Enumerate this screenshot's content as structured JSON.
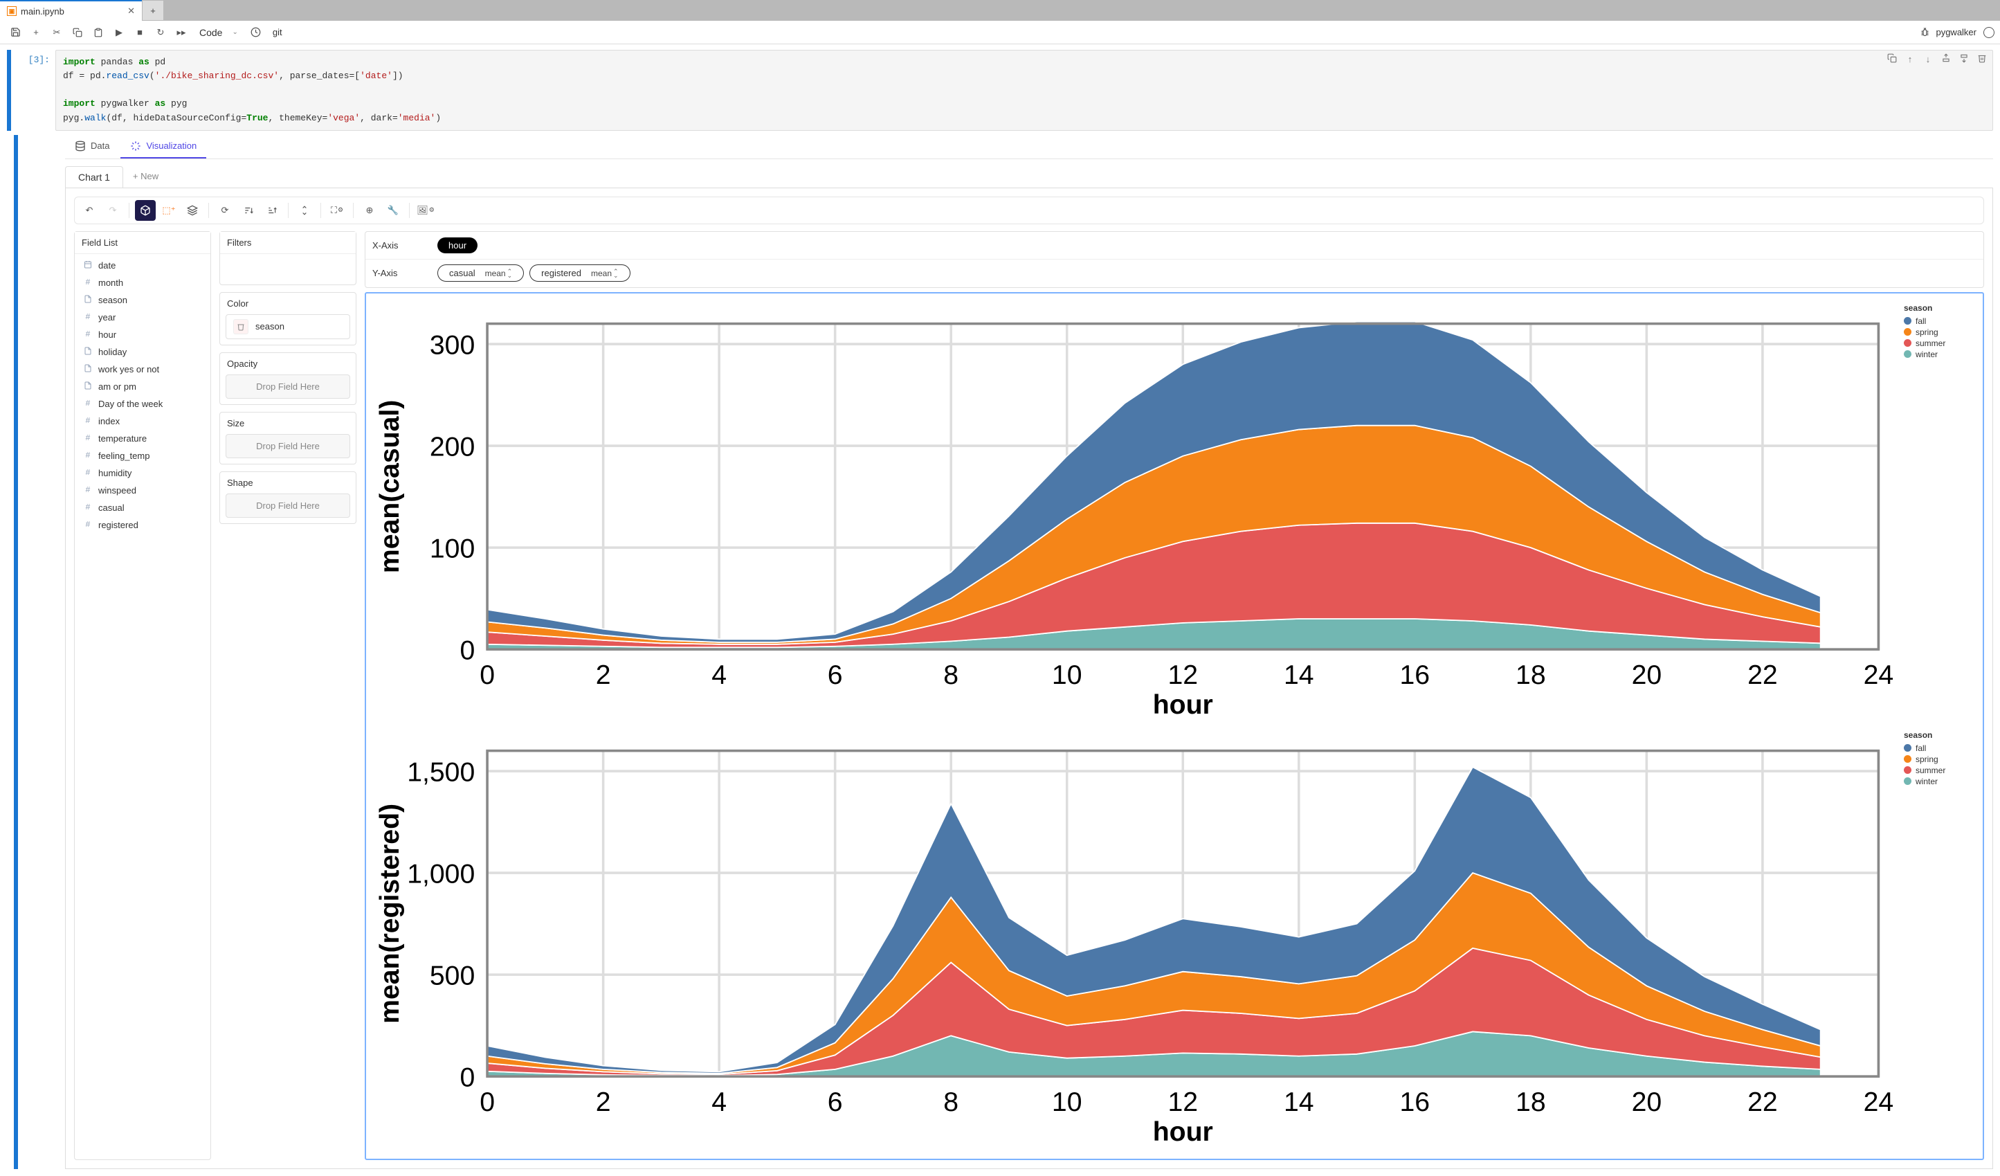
{
  "tab": {
    "filename": "main.ipynb"
  },
  "toolbar": {
    "celltype": "Code",
    "git": "git",
    "kernel": "pygwalker"
  },
  "cell": {
    "prompt": "[3]:",
    "code_lines": [
      [
        {
          "t": "import ",
          "c": "kw-green"
        },
        {
          "t": "pandas ",
          "c": ""
        },
        {
          "t": "as ",
          "c": "kw-green"
        },
        {
          "t": "pd",
          "c": ""
        }
      ],
      [
        {
          "t": "df ",
          "c": ""
        },
        {
          "t": "= ",
          "c": ""
        },
        {
          "t": "pd.",
          "c": ""
        },
        {
          "t": "read_csv",
          "c": "fn"
        },
        {
          "t": "(",
          "c": ""
        },
        {
          "t": "'./bike_sharing_dc.csv'",
          "c": "str"
        },
        {
          "t": ", parse_dates=[",
          "c": ""
        },
        {
          "t": "'date'",
          "c": "str"
        },
        {
          "t": "])",
          "c": ""
        }
      ],
      [],
      [
        {
          "t": "import ",
          "c": "kw-green"
        },
        {
          "t": "pygwalker ",
          "c": ""
        },
        {
          "t": "as ",
          "c": "kw-green"
        },
        {
          "t": "pyg",
          "c": ""
        }
      ],
      [
        {
          "t": "pyg.",
          "c": ""
        },
        {
          "t": "walk",
          "c": "fn"
        },
        {
          "t": "(df, hideDataSourceConfig=",
          "c": ""
        },
        {
          "t": "True",
          "c": "kw-green"
        },
        {
          "t": ", themeKey=",
          "c": ""
        },
        {
          "t": "'vega'",
          "c": "str"
        },
        {
          "t": ", dark=",
          "c": ""
        },
        {
          "t": "'media'",
          "c": "str"
        },
        {
          "t": ")",
          "c": ""
        }
      ]
    ]
  },
  "viz": {
    "tabs": {
      "data": "Data",
      "visualization": "Visualization"
    },
    "charttab": "Chart 1",
    "newtab": "+ New",
    "field_list_label": "Field List",
    "fields": [
      {
        "name": "date",
        "icon": "cal"
      },
      {
        "name": "month",
        "icon": "hash"
      },
      {
        "name": "season",
        "icon": "doc"
      },
      {
        "name": "year",
        "icon": "hash"
      },
      {
        "name": "hour",
        "icon": "hash"
      },
      {
        "name": "holiday",
        "icon": "doc"
      },
      {
        "name": "work yes or not",
        "icon": "doc"
      },
      {
        "name": "am or pm",
        "icon": "doc"
      },
      {
        "name": "Day of the week",
        "icon": "hash"
      },
      {
        "name": "index",
        "icon": "hash"
      },
      {
        "name": "temperature",
        "icon": "hash"
      },
      {
        "name": "feeling_temp",
        "icon": "hash"
      },
      {
        "name": "humidity",
        "icon": "hash"
      },
      {
        "name": "winspeed",
        "icon": "hash"
      },
      {
        "name": "casual",
        "icon": "hash"
      },
      {
        "name": "registered",
        "icon": "hash"
      }
    ],
    "encodings": {
      "filters": "Filters",
      "color": "Color",
      "color_field": "season",
      "opacity": "Opacity",
      "size": "Size",
      "shape": "Shape",
      "drop": "Drop Field Here"
    },
    "shelves": {
      "x": "X-Axis",
      "y": "Y-Axis",
      "x_field": "hour",
      "y_fields": [
        {
          "name": "casual",
          "agg": "mean"
        },
        {
          "name": "registered",
          "agg": "mean"
        }
      ]
    },
    "legend_title": "season",
    "legend_items": [
      {
        "name": "fall",
        "color": "#4c78a8"
      },
      {
        "name": "spring",
        "color": "#f58518"
      },
      {
        "name": "summer",
        "color": "#e45756"
      },
      {
        "name": "winter",
        "color": "#72b7b2"
      }
    ]
  },
  "chart_data": [
    {
      "type": "area",
      "stacked": true,
      "title": "",
      "xlabel": "hour",
      "ylabel": "mean(casual)",
      "x": [
        0,
        1,
        2,
        3,
        4,
        5,
        6,
        7,
        8,
        9,
        10,
        11,
        12,
        13,
        14,
        15,
        16,
        17,
        18,
        19,
        20,
        21,
        22,
        23
      ],
      "x_ticks": [
        0,
        2,
        4,
        6,
        8,
        10,
        12,
        14,
        16,
        18,
        20,
        22,
        24
      ],
      "ylim": [
        0,
        320
      ],
      "y_ticks": [
        0,
        100,
        200,
        300
      ],
      "series": [
        {
          "name": "winter",
          "color": "#72b7b2",
          "values": [
            5,
            4,
            3,
            2,
            2,
            2,
            3,
            5,
            8,
            12,
            18,
            22,
            26,
            28,
            30,
            30,
            30,
            28,
            24,
            18,
            14,
            10,
            8,
            6
          ]
        },
        {
          "name": "summer",
          "color": "#e45756",
          "values": [
            12,
            9,
            6,
            4,
            3,
            3,
            4,
            10,
            20,
            35,
            52,
            68,
            80,
            88,
            92,
            94,
            94,
            88,
            76,
            60,
            46,
            34,
            24,
            16
          ]
        },
        {
          "name": "spring",
          "color": "#f58518",
          "values": [
            10,
            8,
            5,
            3,
            2,
            2,
            3,
            10,
            22,
            40,
            58,
            74,
            84,
            90,
            94,
            96,
            96,
            92,
            80,
            62,
            46,
            32,
            22,
            14
          ]
        },
        {
          "name": "fall",
          "color": "#4c78a8",
          "values": [
            12,
            9,
            6,
            4,
            3,
            3,
            5,
            12,
            26,
            44,
            62,
            78,
            90,
            96,
            100,
            102,
            102,
            96,
            82,
            64,
            48,
            34,
            24,
            16
          ]
        }
      ]
    },
    {
      "type": "area",
      "stacked": true,
      "title": "",
      "xlabel": "hour",
      "ylabel": "mean(registered)",
      "x": [
        0,
        1,
        2,
        3,
        4,
        5,
        6,
        7,
        8,
        9,
        10,
        11,
        12,
        13,
        14,
        15,
        16,
        17,
        18,
        19,
        20,
        21,
        22,
        23
      ],
      "x_ticks": [
        0,
        2,
        4,
        6,
        8,
        10,
        12,
        14,
        16,
        18,
        20,
        22,
        24
      ],
      "ylim": [
        0,
        1600
      ],
      "y_ticks": [
        0,
        500,
        1000,
        1500
      ],
      "series": [
        {
          "name": "winter",
          "color": "#72b7b2",
          "values": [
            25,
            15,
            8,
            5,
            4,
            10,
            35,
            100,
            200,
            120,
            90,
            100,
            115,
            110,
            100,
            110,
            150,
            220,
            200,
            140,
            100,
            70,
            50,
            35
          ]
        },
        {
          "name": "summer",
          "color": "#e45756",
          "values": [
            40,
            25,
            15,
            8,
            6,
            18,
            70,
            200,
            360,
            210,
            160,
            180,
            210,
            200,
            185,
            200,
            270,
            410,
            370,
            260,
            180,
            130,
            95,
            60
          ]
        },
        {
          "name": "spring",
          "color": "#f58518",
          "values": [
            35,
            22,
            12,
            7,
            5,
            16,
            60,
            180,
            320,
            190,
            145,
            165,
            190,
            180,
            170,
            185,
            250,
            370,
            330,
            235,
            165,
            120,
            85,
            55
          ]
        },
        {
          "name": "fall",
          "color": "#4c78a8",
          "values": [
            50,
            32,
            18,
            10,
            8,
            24,
            90,
            260,
            460,
            260,
            200,
            225,
            260,
            245,
            230,
            255,
            340,
            520,
            470,
            330,
            235,
            170,
            125,
            80
          ]
        }
      ]
    }
  ]
}
